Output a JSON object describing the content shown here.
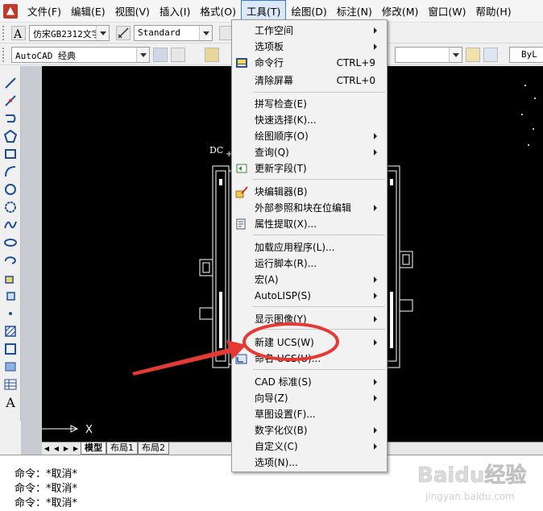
{
  "menubar": {
    "items": [
      "文件(F)",
      "编辑(E)",
      "视图(V)",
      "插入(I)",
      "格式(O)",
      "工具(T)",
      "绘图(D)",
      "标注(N)",
      "修改(M)",
      "窗口(W)",
      "帮助(H)"
    ]
  },
  "toolbar1": {
    "text_style": "仿宋GB2312文字",
    "dim_style": "Standard"
  },
  "toolbar2": {
    "workspace": "AutoCAD 经典",
    "bylayer": "ByL"
  },
  "drawing": {
    "dc_label": "DC",
    "plus_label": "+",
    "x_axis_label": "X"
  },
  "layout_tabs": [
    "模型",
    "布局1",
    "布局2"
  ],
  "command_lines": [
    "命令：*取消*",
    "命令：*取消*",
    "命令：*取消*"
  ],
  "tools_menu": {
    "items": [
      {
        "label": "工作空间",
        "shortcut": "",
        "submenu": true
      },
      {
        "label": "选项板",
        "shortcut": "",
        "submenu": true
      },
      {
        "label": "命令行",
        "shortcut": "CTRL+9",
        "submenu": false,
        "icon": "command-line-icon"
      },
      {
        "label": "清除屏幕",
        "shortcut": "CTRL+0",
        "submenu": false
      },
      {
        "label": "拼写检查(E)",
        "shortcut": "",
        "submenu": false
      },
      {
        "label": "快速选择(K)...",
        "shortcut": "",
        "submenu": false
      },
      {
        "label": "绘图顺序(O)",
        "shortcut": "",
        "submenu": true
      },
      {
        "label": "查询(Q)",
        "shortcut": "",
        "submenu": true
      },
      {
        "label": "更新字段(T)",
        "shortcut": "",
        "submenu": false,
        "icon": "update-fields-icon"
      },
      {
        "label": "块编辑器(B)",
        "shortcut": "",
        "submenu": false,
        "icon": "block-editor-icon"
      },
      {
        "label": "外部参照和块在位编辑",
        "shortcut": "",
        "submenu": true
      },
      {
        "label": "属性提取(X)...",
        "shortcut": "",
        "submenu": false,
        "icon": "attribute-extract-icon"
      },
      {
        "label": "加载应用程序(L)...",
        "shortcut": "",
        "submenu": false
      },
      {
        "label": "运行脚本(R)...",
        "shortcut": "",
        "submenu": false
      },
      {
        "label": "宏(A)",
        "shortcut": "",
        "submenu": true
      },
      {
        "label": "AutoLISP(S)",
        "shortcut": "",
        "submenu": true
      },
      {
        "label": "显示图像(Y)",
        "shortcut": "",
        "submenu": true
      },
      {
        "label": "新建 UCS(W)",
        "shortcut": "",
        "submenu": true
      },
      {
        "label": "命名 UCS(U)...",
        "shortcut": "",
        "submenu": false,
        "icon": "named-ucs-icon"
      },
      {
        "label": "CAD 标准(S)",
        "shortcut": "",
        "submenu": true
      },
      {
        "label": "向导(Z)",
        "shortcut": "",
        "submenu": true
      },
      {
        "label": "草图设置(F)...",
        "shortcut": "",
        "submenu": false
      },
      {
        "label": "数字化仪(B)",
        "shortcut": "",
        "submenu": true
      },
      {
        "label": "自定义(C)",
        "shortcut": "",
        "submenu": true
      },
      {
        "label": "选项(N)...",
        "shortcut": "",
        "submenu": false
      }
    ]
  },
  "annotation": {
    "highlight_color": "#e53935",
    "highlighted_item": "新建 UCS(W)"
  },
  "watermark": {
    "brand": "Baidu经验",
    "url": "jingyan.baidu.com"
  }
}
